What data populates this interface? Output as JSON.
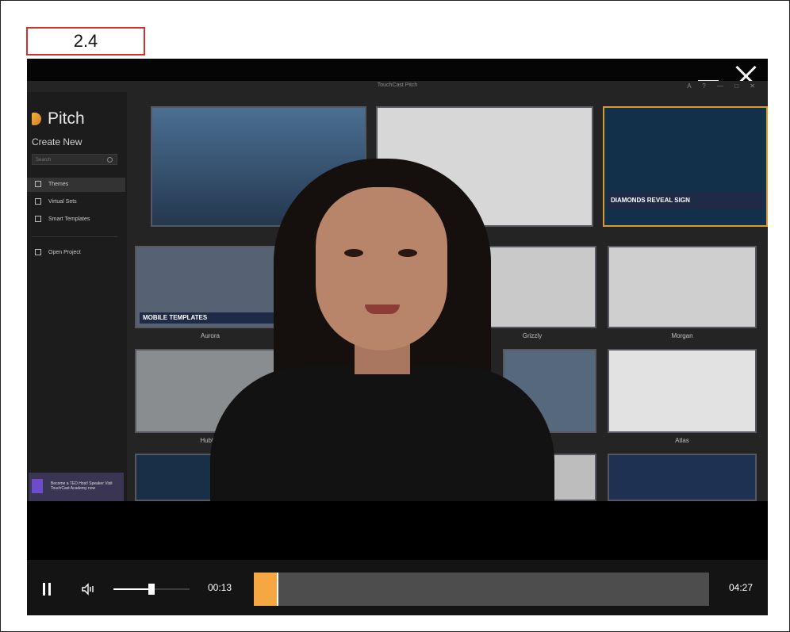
{
  "tag": {
    "label": "2.4"
  },
  "app": {
    "title": "TouchCast Pitch",
    "controls": "A ? — □ ✕",
    "logo": "Pitch",
    "create_new": "Create New",
    "search_placeholder": "Search",
    "nav": [
      {
        "label": "Themes"
      },
      {
        "label": "Virtual Sets"
      },
      {
        "label": "Smart Templates"
      },
      {
        "label": "Open Project"
      }
    ],
    "promo": "Become a TED Host! Speaker Visit TouchCast Academy now",
    "themes": [
      "Aurora",
      "Grizzly",
      "Morgan",
      "Hubble",
      "Atlas"
    ],
    "banners": [
      "MOBILE TEMPLATES",
      "DIAMONDS REVEAL SIGN"
    ]
  },
  "player": {
    "current_time": "00:13",
    "duration": "04:27",
    "progress_fraction": 0.05,
    "volume_fraction": 0.5
  }
}
